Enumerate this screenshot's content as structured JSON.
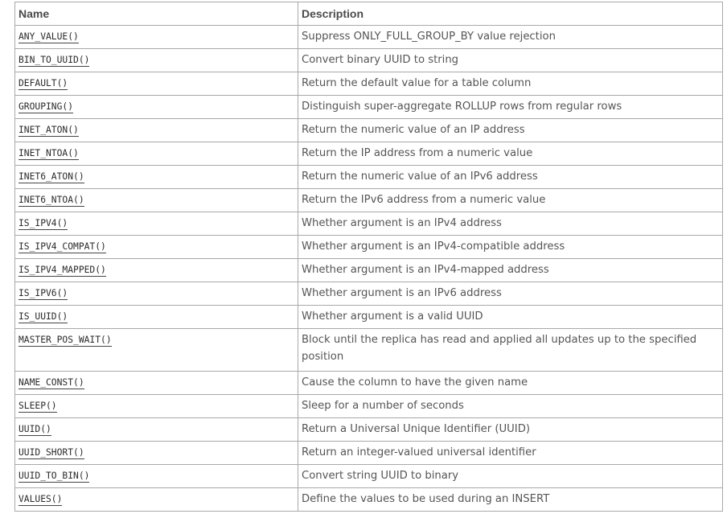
{
  "table": {
    "headers": {
      "name": "Name",
      "description": "Description"
    },
    "rows": [
      {
        "name": "ANY_VALUE()",
        "description": "Suppress ONLY_FULL_GROUP_BY value rejection"
      },
      {
        "name": "BIN_TO_UUID()",
        "description": "Convert binary UUID to string"
      },
      {
        "name": "DEFAULT()",
        "description": "Return the default value for a table column"
      },
      {
        "name": "GROUPING()",
        "description": "Distinguish super-aggregate ROLLUP rows from regular rows"
      },
      {
        "name": "INET_ATON()",
        "description": "Return the numeric value of an IP address"
      },
      {
        "name": "INET_NTOA()",
        "description": "Return the IP address from a numeric value"
      },
      {
        "name": "INET6_ATON()",
        "description": "Return the numeric value of an IPv6 address"
      },
      {
        "name": "INET6_NTOA()",
        "description": "Return the IPv6 address from a numeric value"
      },
      {
        "name": "IS_IPV4()",
        "description": "Whether argument is an IPv4 address"
      },
      {
        "name": "IS_IPV4_COMPAT()",
        "description": "Whether argument is an IPv4-compatible address"
      },
      {
        "name": "IS_IPV4_MAPPED()",
        "description": "Whether argument is an IPv4-mapped address"
      },
      {
        "name": "IS_IPV6()",
        "description": "Whether argument is an IPv6 address"
      },
      {
        "name": "IS_UUID()",
        "description": "Whether argument is a valid UUID"
      },
      {
        "name": "MASTER_POS_WAIT()",
        "description": "Block until the replica has read and applied all updates up to the specified position"
      },
      {
        "name": "NAME_CONST()",
        "description": "Cause the column to have the given name"
      },
      {
        "name": "SLEEP()",
        "description": "Sleep for a number of seconds"
      },
      {
        "name": "UUID()",
        "description": "Return a Universal Unique Identifier (UUID)"
      },
      {
        "name": "UUID_SHORT()",
        "description": "Return an integer-valued universal identifier"
      },
      {
        "name": "UUID_TO_BIN()",
        "description": "Convert string UUID to binary"
      },
      {
        "name": "VALUES()",
        "description": "Define the values to be used during an INSERT"
      }
    ]
  }
}
